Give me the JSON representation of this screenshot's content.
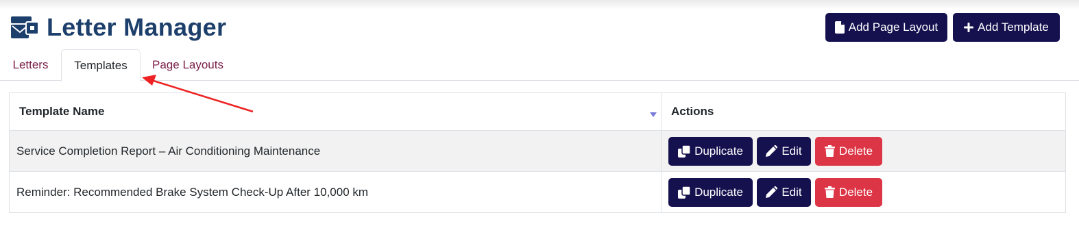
{
  "app": {
    "title": "Letter Manager",
    "logo_icon": "envelope-stack-icon"
  },
  "toolbar": {
    "add_page_layout_label": "Add Page Layout",
    "add_template_label": "Add Template"
  },
  "tabs": [
    {
      "label": "Letters",
      "active": false
    },
    {
      "label": "Templates",
      "active": true
    },
    {
      "label": "Page Layouts",
      "active": false
    }
  ],
  "table": {
    "columns": [
      "Template Name",
      "Actions"
    ],
    "rows": [
      {
        "name": "Service Completion Report – Air Conditioning Maintenance"
      },
      {
        "name": "Reminder: Recommended Brake System Check-Up After 10,000 km"
      }
    ],
    "actions": {
      "duplicate_label": "Duplicate",
      "edit_label": "Edit",
      "delete_label": "Delete"
    }
  },
  "colors": {
    "title": "#1d3f6b",
    "primary_button": "#15114f",
    "delete_button": "#dc3545",
    "tab_link": "#7a1e46",
    "annotation_arrow": "#ee2222"
  }
}
